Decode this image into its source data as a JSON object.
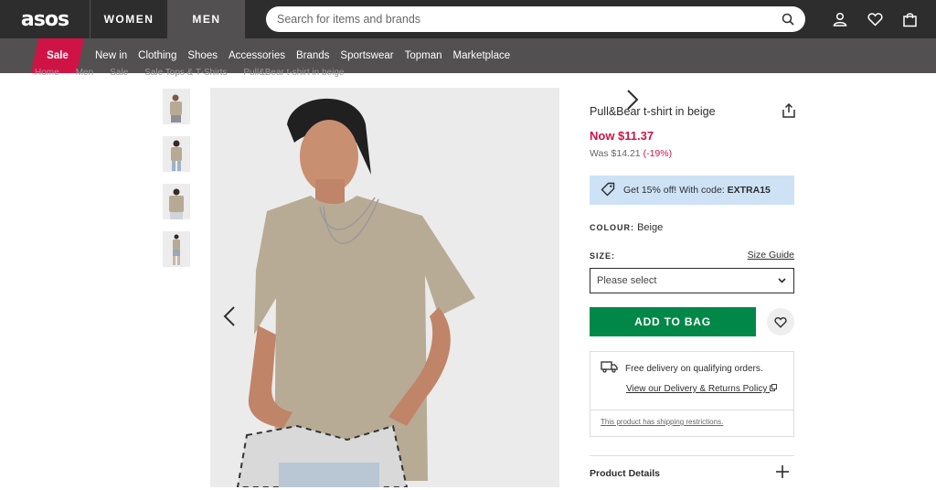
{
  "header": {
    "logo": "asos",
    "tabs": [
      "WOMEN",
      "MEN"
    ],
    "active_tab": "MEN",
    "search_placeholder": "Search for items and brands"
  },
  "nav": {
    "sale": "Sale",
    "items": [
      "New in",
      "Clothing",
      "Shoes",
      "Accessories",
      "Brands",
      "Sportswear",
      "Topman",
      "Marketplace"
    ]
  },
  "breadcrumb": [
    "Home",
    "Men",
    "Sale",
    "Sale Tops & T-Shirts",
    "Pull&Bear t-shirt in beige"
  ],
  "product": {
    "title": "Pull&Bear t-shirt in beige",
    "price_now": "Now $11.37",
    "price_was": "Was $14.21",
    "discount": "(-19%)",
    "promo_text": "Get 15% off! With code:",
    "promo_code": "EXTRA15",
    "colour_label": "COLOUR:",
    "colour_value": "Beige",
    "size_label": "SIZE:",
    "size_guide": "Size Guide",
    "size_placeholder": "Please select",
    "add_to_bag": "ADD TO BAG",
    "delivery_text": "Free delivery on qualifying orders.",
    "delivery_link": "View our Delivery & Returns Policy",
    "restriction": "This product has shipping restrictions.",
    "details_title": "Product Details"
  },
  "colors": {
    "accent_red": "#d01345",
    "add_green": "#018849",
    "promo_blue": "#cde2f5",
    "dark": "#2d2d2d"
  }
}
